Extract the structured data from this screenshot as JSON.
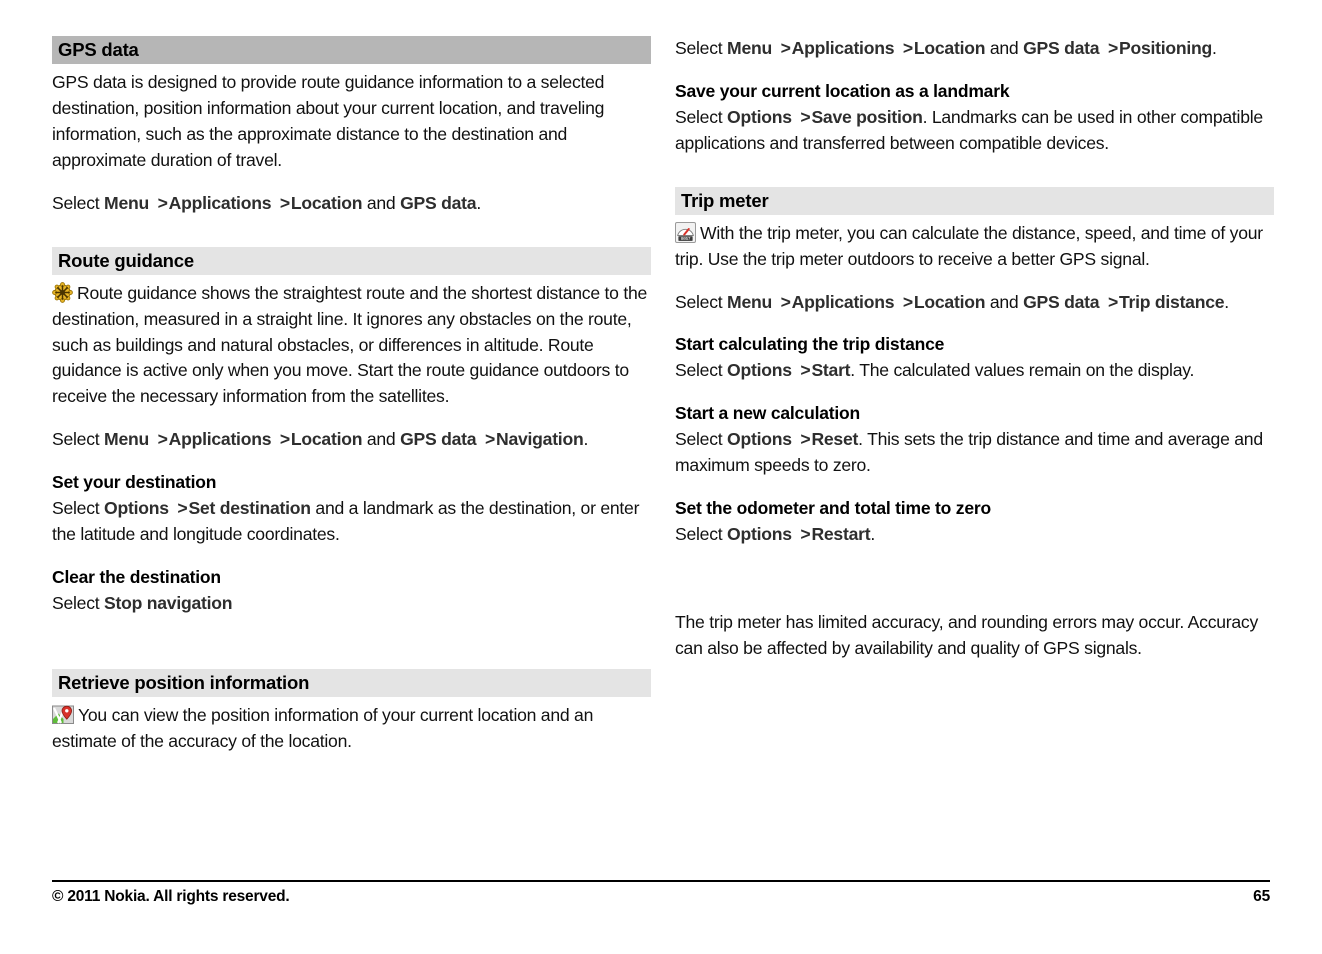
{
  "document": {
    "page_number": "65",
    "copyright": "© 2011 Nokia. All rights reserved."
  },
  "left_column": {
    "gps_data": {
      "heading": "GPS data",
      "intro": "GPS data is designed to provide route guidance information to a selected destination, position information about your current location, and traveling information, such as the approximate distance to the destination and approximate duration of travel.",
      "path": {
        "select": "Select",
        "menu": "Menu",
        "arrow1": ">",
        "applications": "Applications",
        "arrow2": ">",
        "location": "Location",
        "and": "and",
        "gps_data": "GPS data",
        "period": "."
      }
    },
    "route_guidance": {
      "heading": "Route guidance",
      "icon": "ship-wheel-icon",
      "intro": "Route guidance shows the straightest route and the shortest distance to the destination, measured in a straight line. It ignores any obstacles on the route, such as buildings and natural obstacles, or differences in altitude. Route guidance is active only when you move. Start the route guidance outdoors to receive the necessary information from the satellites.",
      "path": {
        "select": "Select",
        "menu": "Menu",
        "arrow1": ">",
        "applications": "Applications",
        "arrow2": ">",
        "location": "Location",
        "and": "and",
        "gps_data": "GPS data",
        "arrow3": ">",
        "navigation": "Navigation",
        "period": "."
      },
      "set_destination": {
        "heading": "Set your destination",
        "select": "Select",
        "options": "Options",
        "arrow": ">",
        "command": "Set destination",
        "rest": " and a landmark as the destination, or enter the latitude and longitude coordinates."
      },
      "clear_destination": {
        "heading": "Clear the destination",
        "select": "Select",
        "command": "Stop navigation"
      }
    },
    "retrieve_position": {
      "heading": "Retrieve position information",
      "icon": "map-pin-icon",
      "body": "You can view the position information of your current location and an estimate of the accuracy of the location."
    }
  },
  "right_column": {
    "positioning_path": {
      "select": "Select",
      "menu": "Menu",
      "arrow1": ">",
      "applications": "Applications",
      "arrow2": ">",
      "location": "Location",
      "and": "and",
      "gps_data": "GPS data",
      "arrow3": ">",
      "positioning": "Positioning",
      "period": "."
    },
    "save_landmark": {
      "heading": "Save your current location as a landmark",
      "select": "Select",
      "options": "Options",
      "arrow": ">",
      "command": "Save position",
      "rest": ". Landmarks can be used in other compatible applications and transferred between compatible devices."
    },
    "trip_meter": {
      "heading": "Trip meter",
      "icon": "trip-meter-gauge-icon",
      "intro": "With the trip meter, you can calculate the distance, speed, and time of your trip. Use the trip meter outdoors to receive a better GPS signal.",
      "path": {
        "select": "Select",
        "menu": "Menu",
        "arrow1": ">",
        "applications": "Applications",
        "arrow2": ">",
        "location": "Location",
        "and": "and",
        "gps_data": "GPS data",
        "arrow3": ">",
        "trip_distance": "Trip distance",
        "period": "."
      },
      "start_calculating": {
        "heading": "Start calculating the trip distance",
        "select": "Select",
        "options": "Options",
        "arrow": ">",
        "command": "Start",
        "rest": ". The calculated values remain on the display."
      },
      "new_calculation": {
        "heading": "Start a new calculation",
        "select": "Select",
        "options": "Options",
        "arrow": ">",
        "command": "Reset",
        "rest": ". This sets the trip distance and time and average and maximum speeds to zero."
      },
      "odometer_zero": {
        "heading": "Set the odometer and total time to zero",
        "select": "Select",
        "options": "Options",
        "arrow": ">",
        "command": "Restart",
        "rest": "."
      },
      "note": "The trip meter has limited accuracy, and rounding errors may occur. Accuracy can also be affected by availability and quality of GPS signals."
    }
  },
  "colors": {
    "header_dark": "#b6b6b6",
    "header_light": "#e4e4e4",
    "text": "#111111",
    "ui_bold": "#2e2e2e",
    "icon_gold": "#e8b526",
    "icon_red": "#d8322a"
  }
}
